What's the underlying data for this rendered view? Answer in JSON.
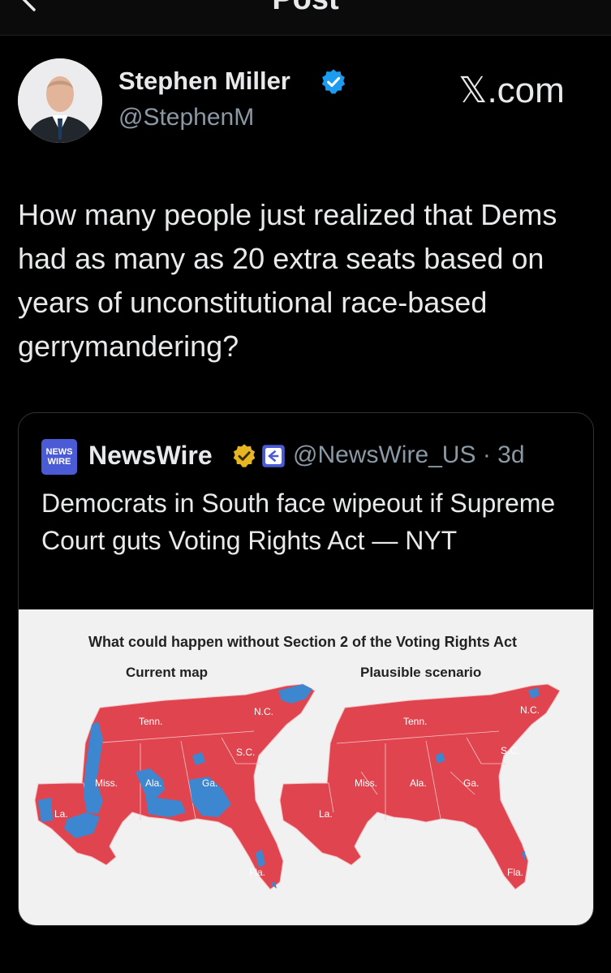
{
  "header": {
    "title": "Post",
    "back_icon": "back-arrow-icon"
  },
  "author": {
    "name": "Stephen Miller",
    "handle": "@StephenM",
    "verified_icon": "verified-badge-icon",
    "verified_color": "#1d9bf0"
  },
  "site_label": "𝕏.com",
  "post": {
    "text": "How many people just realized that Dems had as many as 20 extra seats based on years of unconstitutional race-based gerrymandering?"
  },
  "quote": {
    "logo_text": "NEWS WIRE",
    "name": "NewsWire",
    "meta": "@NewsWire_US · 3d",
    "text": "Democrats in South face wipeout if Supreme Court guts Voting Rights Act — NYT",
    "gold_badge_color": "#e8b623"
  },
  "map_graphic": {
    "title": "What could happen without Section 2 of the Voting Rights Act",
    "left_label": "Current map",
    "right_label": "Plausible scenario",
    "state_labels": [
      "Tenn.",
      "N.C.",
      "S.C.",
      "Miss.",
      "Ala.",
      "Ga.",
      "La.",
      "Fla."
    ],
    "colors": {
      "republican": "#e0454f",
      "democrat": "#3d86d0"
    }
  }
}
